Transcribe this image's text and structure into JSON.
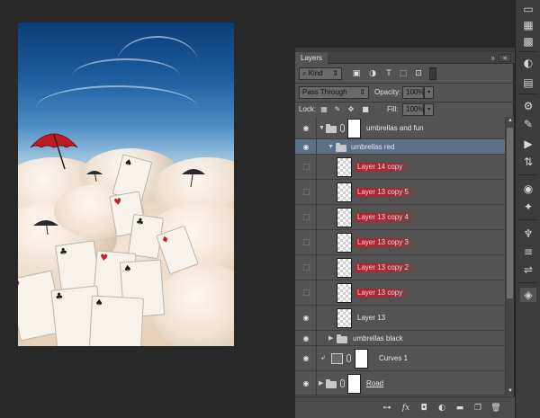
{
  "panel": {
    "tab_label": "Layers",
    "collapse_glyph": "»",
    "menu_glyph": "≡"
  },
  "filter": {
    "kind_label": "Kind",
    "filter_icons": [
      "pixel-filter-icon",
      "adjustment-filter-icon",
      "type-filter-icon",
      "shape-filter-icon",
      "smart-object-filter-icon"
    ]
  },
  "blend": {
    "mode": "Pass Through",
    "opacity_label": "Opacity:",
    "opacity_value": "100%",
    "lock_label": "Lock:",
    "fill_label": "Fill:",
    "fill_value": "100%"
  },
  "layers": [
    {
      "name": "umbrellas and fun",
      "type": "group",
      "visible": true,
      "level": 0,
      "expanded": true,
      "has_mask": true
    },
    {
      "name": "umbrellas red",
      "type": "group",
      "visible": true,
      "level": 1,
      "expanded": true,
      "selected": true
    },
    {
      "name": "Layer 14 copy",
      "type": "pixel",
      "visible": false,
      "level": 2,
      "highlight": "#be1e2d"
    },
    {
      "name": "Layer 13 copy 5",
      "type": "pixel",
      "visible": false,
      "level": 2,
      "highlight": "#be1e2d"
    },
    {
      "name": "Layer 13 copy 4",
      "type": "pixel",
      "visible": false,
      "level": 2,
      "highlight": "#be1e2d"
    },
    {
      "name": "Layer 13 copy 3",
      "type": "pixel",
      "visible": false,
      "level": 2,
      "highlight": "#be1e2d"
    },
    {
      "name": "Layer 13 copy 2",
      "type": "pixel",
      "visible": false,
      "level": 2,
      "highlight": "#be1e2d"
    },
    {
      "name": "Layer 13 copy",
      "type": "pixel",
      "visible": false,
      "level": 2,
      "highlight": "#be1e2d"
    },
    {
      "name": "Layer 13",
      "type": "pixel",
      "visible": true,
      "level": 2
    },
    {
      "name": "umbrellas black",
      "type": "group",
      "visible": true,
      "level": 1,
      "expanded": false
    },
    {
      "name": "Curves 1",
      "type": "adjustment",
      "visible": true,
      "level": 0,
      "clipped": true
    },
    {
      "name": "Road",
      "type": "group",
      "visible": true,
      "level": 0,
      "expanded": false,
      "has_mask": true
    }
  ],
  "bottom_bar": {
    "fx_label": "fx",
    "icons": [
      "link-layers-icon",
      "fx-icon",
      "add-mask-icon",
      "adjustment-layer-icon",
      "new-group-icon",
      "new-layer-icon",
      "delete-layer-icon"
    ]
  },
  "colors": {
    "panel_bg": "#535353",
    "selection": "#5d6f86",
    "app_bg": "#282828",
    "highlight_red": "#be1e2d"
  }
}
